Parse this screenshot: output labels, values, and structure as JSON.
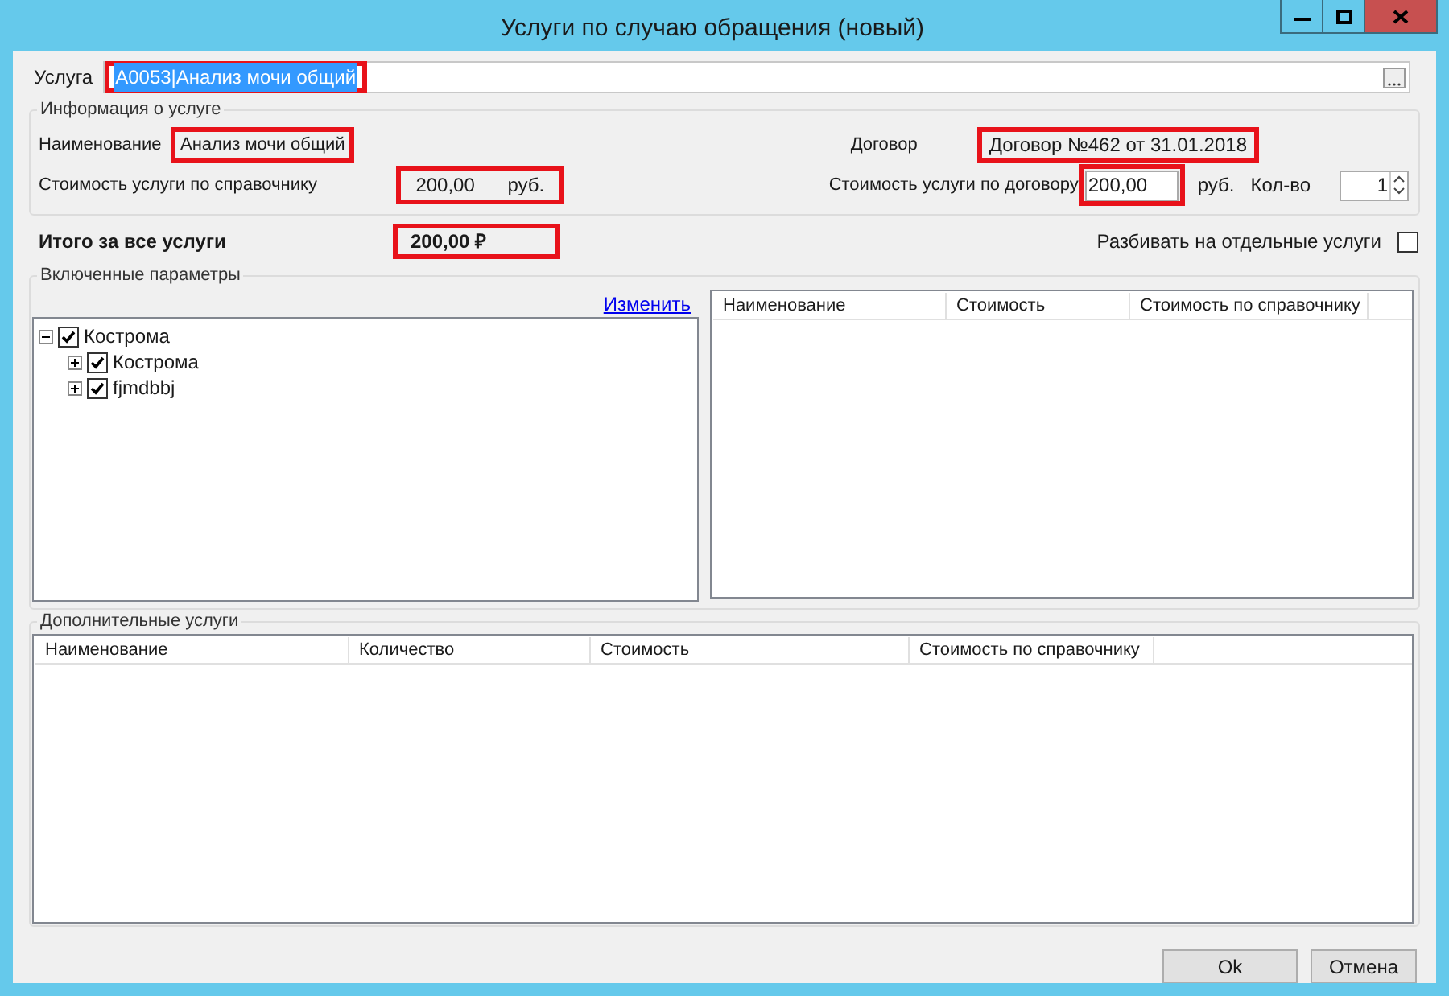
{
  "window": {
    "title": "Услуги по случаю обращения (новый)"
  },
  "service": {
    "label": "Услуга",
    "value": "A0053|Анализ мочи общий",
    "highlighted": true
  },
  "info": {
    "legend": "Информация о услуге",
    "name": {
      "label": "Наименование",
      "value": "Анализ мочи общий",
      "highlighted": true
    },
    "contract": {
      "label": "Договор",
      "value": "Договор №462 от 31.01.2018",
      "highlighted": true
    },
    "ref_price": {
      "label": "Стоимость услуги по справочнику",
      "value": "200,00",
      "unit": "руб.",
      "highlighted": true
    },
    "contract_price": {
      "label": "Стоимость услуги по договору",
      "value": "200,00",
      "unit": "руб.",
      "highlighted": true
    },
    "quantity": {
      "label": "Кол-во",
      "value": "1"
    }
  },
  "total": {
    "label": "Итого за все услуги",
    "value": "200,00 ₽",
    "highlighted": true
  },
  "split": {
    "label": "Разбивать на отдельные услуги",
    "checked": false
  },
  "params": {
    "legend": "Включенные параметры",
    "link": "Изменить",
    "tree": [
      {
        "label": "Кострома",
        "checked": true,
        "expanded": true,
        "children": [
          {
            "label": "Кострома",
            "checked": true,
            "expanded": false
          },
          {
            "label": "fjmdbbj",
            "checked": true,
            "expanded": false
          }
        ]
      }
    ],
    "columns": [
      "Наименование",
      "Стоимость",
      "Стоимость по справочнику"
    ]
  },
  "extra": {
    "legend": "Дополнительные услуги",
    "columns": [
      "Наименование",
      "Количество",
      "Стоимость",
      "Стоимость по справочнику"
    ]
  },
  "buttons": [
    "Ok",
    "Отмена"
  ]
}
